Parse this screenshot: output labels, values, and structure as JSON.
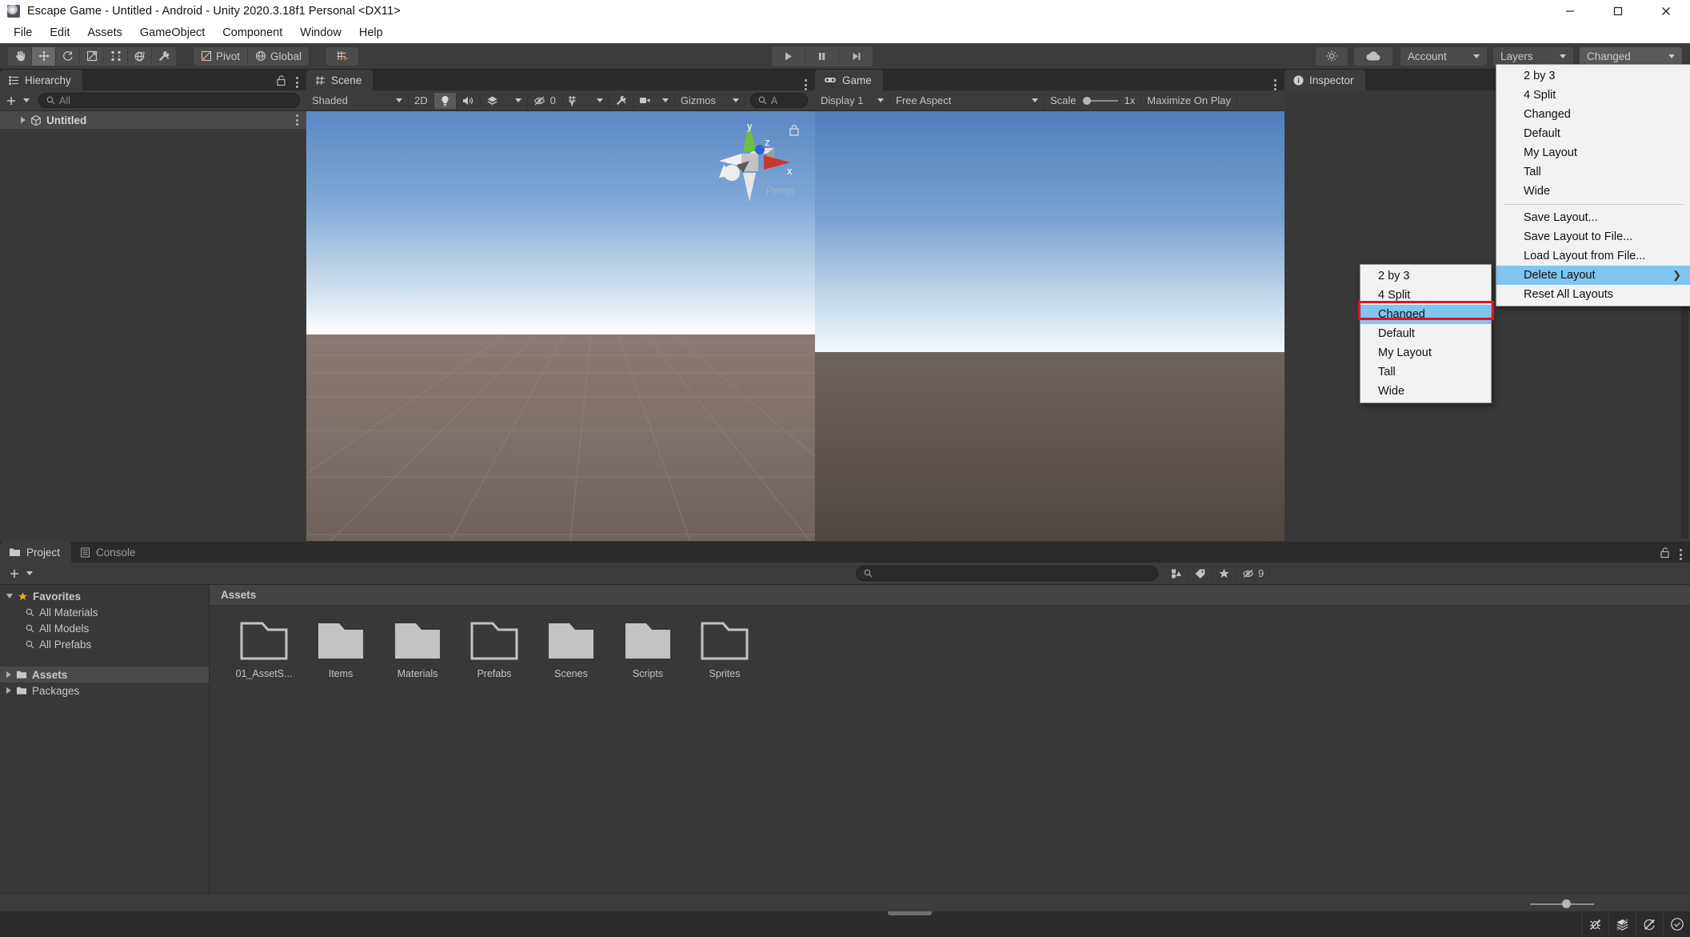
{
  "window": {
    "title": "Escape Game - Untitled - Android - Unity 2020.3.18f1 Personal <DX11>",
    "app_icon": "unity-icon",
    "minimize": "minimize-icon",
    "maximize": "maximize-icon",
    "close": "close-icon"
  },
  "menubar": {
    "items": [
      "File",
      "Edit",
      "Assets",
      "GameObject",
      "Component",
      "Window",
      "Help"
    ]
  },
  "toolbar": {
    "tools": [
      "hand-tool",
      "move-tool",
      "rotate-tool",
      "scale-tool",
      "rect-tool",
      "transform-tool",
      "custom-tool"
    ],
    "pivot_label": "Pivot",
    "global_label": "Global",
    "grid_snap": "grid-snap-icon",
    "play": "play-icon",
    "pause": "pause-icon",
    "step": "step-icon",
    "collab_icon": "cloud-icon",
    "services_icon": "services-icon",
    "account_label": "Account",
    "layers_label": "Layers",
    "layout_label": "Changed"
  },
  "hierarchy": {
    "tab": "Hierarchy",
    "lock_icon": "lock-icon",
    "menu_icon": "kebab-icon",
    "add_label": "+",
    "search_placeholder": "All",
    "items": [
      {
        "label": "Untitled",
        "icon": "unity-scene-icon"
      }
    ]
  },
  "scene": {
    "tab": "Scene",
    "draw_mode": "Shaded",
    "two_d": "2D",
    "lighting_icon": "lightbulb-icon",
    "audio_icon": "audio-icon",
    "fx_icon": "effects-icon",
    "hidden_label": "0",
    "grid_icon": "grid-icon",
    "tools_icon": "tools-icon",
    "camera_icon": "camera-icon",
    "gizmos_label": "Gizmos",
    "search_placeholder": "A",
    "gizmo_axes": [
      "x",
      "y",
      "z"
    ],
    "persp_label": "Persp"
  },
  "game": {
    "tab": "Game",
    "display": "Display 1",
    "aspect": "Free Aspect",
    "scale_label": "Scale",
    "scale_value": "1x",
    "maximize_label": "Maximize On Play"
  },
  "inspector": {
    "tab": "Inspector",
    "info_icon": "info-icon"
  },
  "project": {
    "tabs": [
      {
        "label": "Project",
        "icon": "folder-icon",
        "active": true
      },
      {
        "label": "Console",
        "icon": "console-icon",
        "active": false
      }
    ],
    "add_label": "+",
    "search_placeholder": "",
    "search_icon": "search-icon",
    "filter_type_icon": "filter-type-icon",
    "filter_label_icon": "tag-icon",
    "favorite_icon": "star-icon",
    "hidden_count": "9",
    "hidden_icon": "eye-off-icon",
    "favorites_label": "Favorites",
    "favorites": [
      "All Materials",
      "All Models",
      "All Prefabs"
    ],
    "tree": [
      {
        "label": "Assets",
        "selected": true
      },
      {
        "label": "Packages",
        "selected": false
      }
    ],
    "assets_header": "Assets",
    "folders": [
      {
        "label": "01_AssetS...",
        "empty": true
      },
      {
        "label": "Items",
        "empty": false
      },
      {
        "label": "Materials",
        "empty": false
      },
      {
        "label": "Prefabs",
        "empty": true
      },
      {
        "label": "Scenes",
        "empty": false
      },
      {
        "label": "Scripts",
        "empty": false
      },
      {
        "label": "Sprites",
        "empty": true
      }
    ]
  },
  "layout_menu": {
    "layouts": [
      "2 by 3",
      "4 Split",
      "Changed",
      "Default",
      "My Layout",
      "Tall",
      "Wide"
    ],
    "actions": [
      {
        "label": "Save Layout...",
        "submenu": false,
        "highlighted": false
      },
      {
        "label": "Save Layout to File...",
        "submenu": false,
        "highlighted": false
      },
      {
        "label": "Load Layout from File...",
        "submenu": false,
        "highlighted": false
      },
      {
        "label": "Delete Layout",
        "submenu": true,
        "highlighted": true
      },
      {
        "label": "Reset All Layouts",
        "submenu": false,
        "highlighted": false
      }
    ],
    "submenu_arrow": "chevron-right-icon"
  },
  "delete_submenu": {
    "items": [
      {
        "label": "2 by 3",
        "highlighted": false
      },
      {
        "label": "4 Split",
        "highlighted": false
      },
      {
        "label": "Changed",
        "highlighted": true
      },
      {
        "label": "Default",
        "highlighted": false
      },
      {
        "label": "My Layout",
        "highlighted": false
      },
      {
        "label": "Tall",
        "highlighted": false
      },
      {
        "label": "Wide",
        "highlighted": false
      }
    ]
  },
  "statusbar": {
    "icons": [
      "bug-off-icon",
      "layers-off-icon",
      "sync-off-icon",
      "check-circle-icon"
    ]
  },
  "colors": {
    "highlight_blue": "#7fc5f0",
    "annotation_red": "#e81123",
    "panel_bg": "#383838",
    "toolbar_bg": "#3c3c3c",
    "tabrow_bg": "#2b2b2b"
  }
}
